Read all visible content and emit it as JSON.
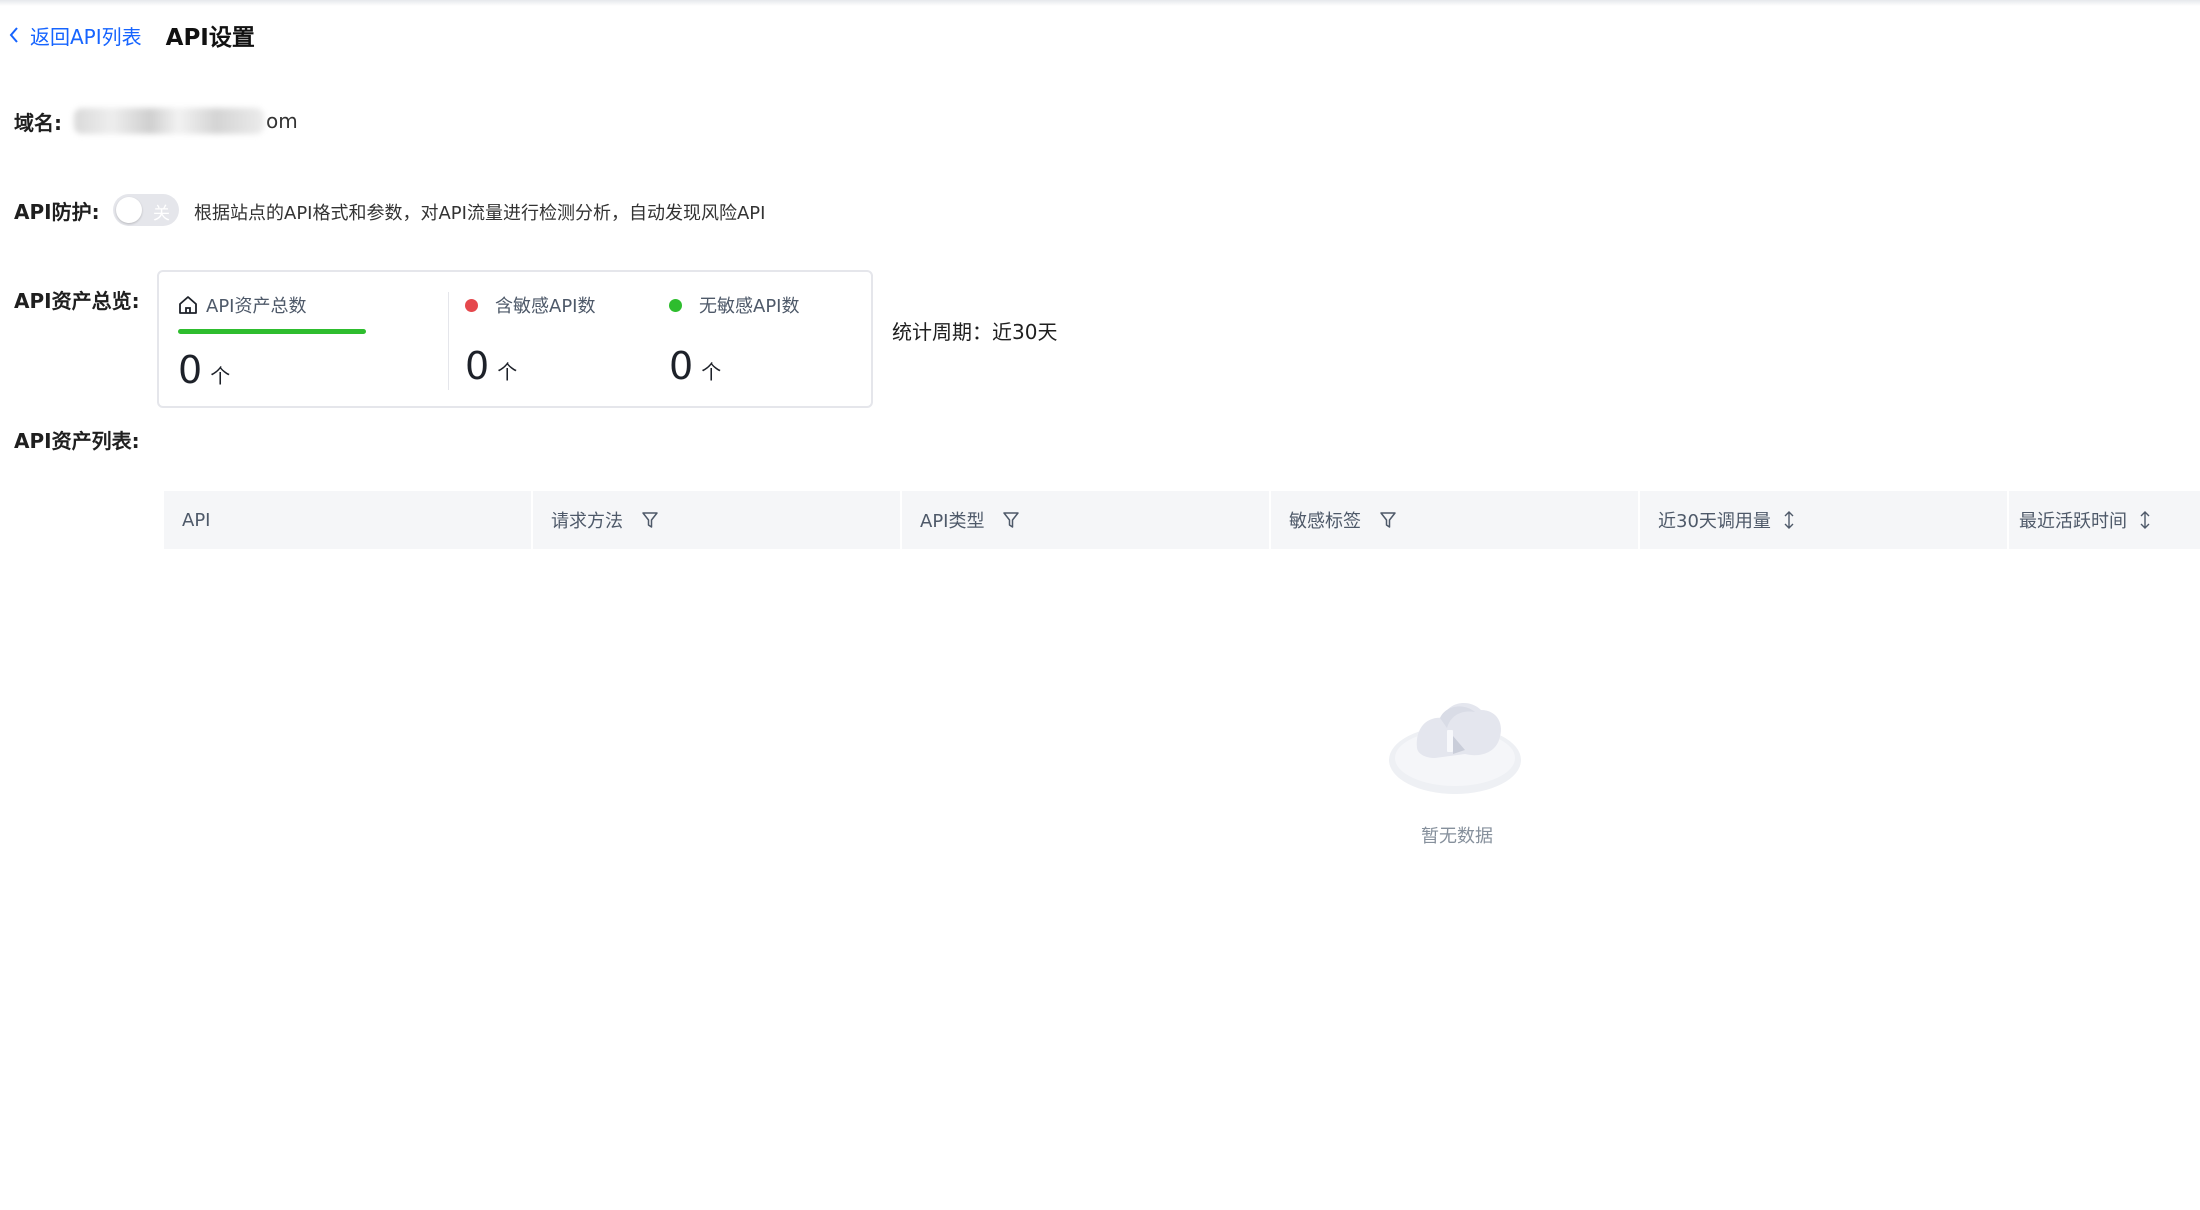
{
  "header": {
    "back_label": "返回API列表",
    "title": "API设置"
  },
  "domain": {
    "label": "域名:",
    "value_visible_suffix": "om"
  },
  "api_protect": {
    "label": "API防护:",
    "toggle_state_text": "关",
    "description": "根据站点的API格式和参数，对API流量进行检测分析，自动发现风险API"
  },
  "overview": {
    "label": "API资产总览:",
    "stats": [
      {
        "label": "API资产总数",
        "value": "0",
        "unit": "个",
        "icon": "home-icon"
      },
      {
        "label": "含敏感API数",
        "value": "0",
        "unit": "个",
        "dot_color": "#e5484d"
      },
      {
        "label": "无敏感API数",
        "value": "0",
        "unit": "个",
        "dot_color": "#2ebd2e"
      }
    ],
    "period": "统计周期：近30天"
  },
  "asset_list": {
    "label": "API资产列表:",
    "columns": [
      {
        "label": "API",
        "icon": null
      },
      {
        "label": "请求方法",
        "icon": "filter-icon"
      },
      {
        "label": "API类型",
        "icon": "filter-icon"
      },
      {
        "label": "敏感标签",
        "icon": "filter-icon"
      },
      {
        "label": "近30天调用量",
        "icon": "sort-icon"
      },
      {
        "label": "最近活跃时间",
        "icon": "sort-icon"
      }
    ],
    "empty_text": "暂无数据"
  },
  "colors": {
    "link": "#1664ff",
    "toggle_off": "#e5e6eb",
    "bar_green": "#2ebd2e",
    "dot_red": "#e5484d"
  }
}
